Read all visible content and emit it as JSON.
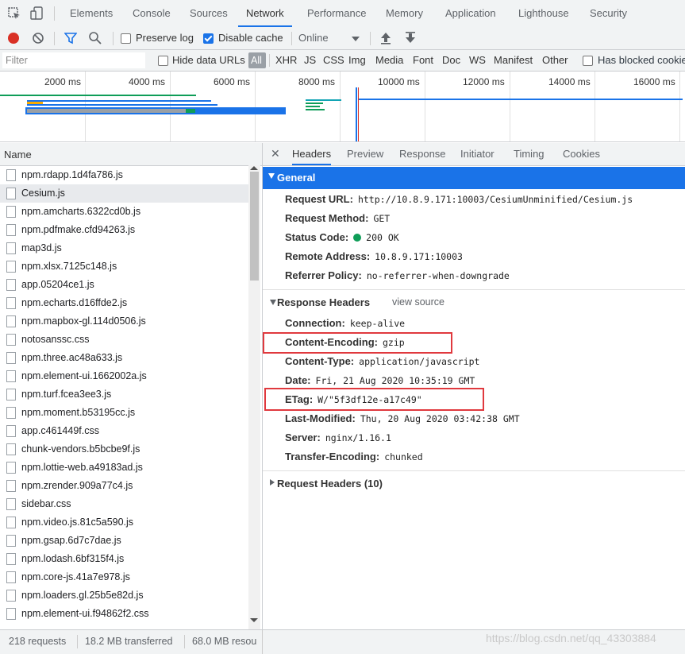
{
  "devtools_tabs": [
    "Elements",
    "Console",
    "Sources",
    "Network",
    "Performance",
    "Memory",
    "Application",
    "Lighthouse",
    "Security"
  ],
  "active_tab": "Network",
  "toolbar": {
    "preserve_log": "Preserve log",
    "disable_cache": "Disable cache",
    "throttling": "Online"
  },
  "filterbar": {
    "placeholder": "Filter",
    "hide_data_urls": "Hide data URLs",
    "types": [
      "All",
      "XHR",
      "JS",
      "CSS",
      "Img",
      "Media",
      "Font",
      "Doc",
      "WS",
      "Manifest",
      "Other"
    ],
    "has_blocked_cookies": "Has blocked cookies"
  },
  "timeline": {
    "ticks": [
      "2000 ms",
      "4000 ms",
      "6000 ms",
      "8000 ms",
      "10000 ms",
      "12000 ms",
      "14000 ms",
      "16000 ms"
    ]
  },
  "request_list": {
    "header": "Name",
    "selected": "Cesium.js",
    "files": [
      "npm.rdapp.1d4fa786.js",
      "Cesium.js",
      "npm.amcharts.6322cd0b.js",
      "npm.pdfmake.cfd94263.js",
      "map3d.js",
      "npm.xlsx.7125c148.js",
      "app.05204ce1.js",
      "npm.echarts.d16ffde2.js",
      "npm.mapbox-gl.114d0506.js",
      "notosanssc.css",
      "npm.three.ac48a633.js",
      "npm.element-ui.1662002a.js",
      "npm.turf.fcea3ee3.js",
      "npm.moment.b53195cc.js",
      "app.c461449f.css",
      "chunk-vendors.b5bcbe9f.js",
      "npm.lottie-web.a49183ad.js",
      "npm.zrender.909a77c4.js",
      "sidebar.css",
      "npm.video.js.81c5a590.js",
      "npm.gsap.6d7c7dae.js",
      "npm.lodash.6bf315f4.js",
      "npm.core-js.41a7e978.js",
      "npm.loaders.gl.25b5e82d.js",
      "npm.element-ui.f94862f2.css"
    ]
  },
  "status_bar": {
    "requests": "218 requests",
    "transferred": "18.2 MB transferred",
    "resources": "68.0 MB resou"
  },
  "detail": {
    "tabs": [
      "Headers",
      "Preview",
      "Response",
      "Initiator",
      "Timing",
      "Cookies"
    ],
    "active_tab": "Headers",
    "general": {
      "title": "General",
      "rows": [
        {
          "key": "Request URL:",
          "value": "http://10.8.9.171:10003/CesiumUnminified/Cesium.js"
        },
        {
          "key": "Request Method:",
          "value": "GET"
        },
        {
          "key": "Status Code:",
          "value": "200 OK"
        },
        {
          "key": "Remote Address:",
          "value": "10.8.9.171:10003"
        },
        {
          "key": "Referrer Policy:",
          "value": "no-referrer-when-downgrade"
        }
      ]
    },
    "response_headers": {
      "title": "Response Headers",
      "view_source": "view source",
      "rows": [
        {
          "key": "Connection:",
          "value": "keep-alive"
        },
        {
          "key": "Content-Encoding:",
          "value": "gzip"
        },
        {
          "key": "Content-Type:",
          "value": "application/javascript"
        },
        {
          "key": "Date:",
          "value": "Fri, 21 Aug 2020 10:35:19 GMT"
        },
        {
          "key": "ETag:",
          "value": "W/\"5f3df12e-a17c49\""
        },
        {
          "key": "Last-Modified:",
          "value": "Thu, 20 Aug 2020 03:42:38 GMT"
        },
        {
          "key": "Server:",
          "value": "nginx/1.16.1"
        },
        {
          "key": "Transfer-Encoding:",
          "value": "chunked"
        }
      ]
    },
    "request_headers": {
      "title": "Request Headers (10)"
    }
  },
  "watermark": "https://blog.csdn.net/qq_43303884",
  "colors": {
    "accent": "#1a73e8",
    "record": "#d93025",
    "status_ok": "#0f9d58",
    "highlight_box": "#e0393e"
  }
}
